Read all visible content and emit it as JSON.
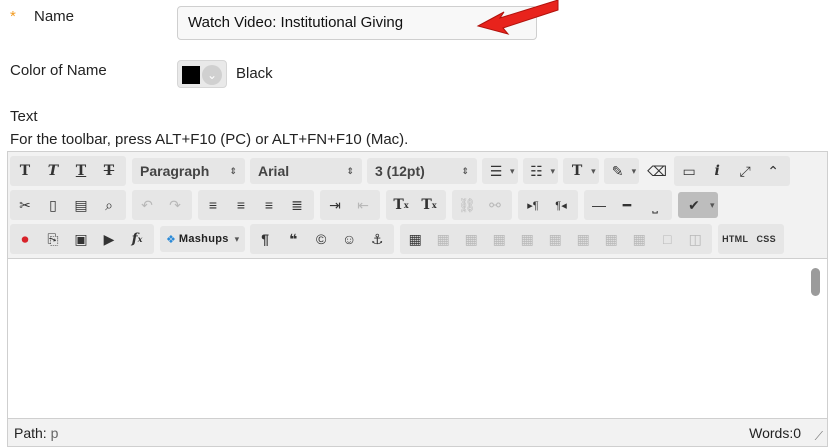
{
  "form": {
    "required_marker": "*",
    "name_label": "Name",
    "name_value": "Watch Video: Institutional Giving",
    "color_label": "Color of Name",
    "color_value": "Black",
    "color_swatch": "#000000",
    "text_label": "Text",
    "toolbar_hint": "For the toolbar, press ALT+F10 (PC) or ALT+FN+F10 (Mac)."
  },
  "toolbar": {
    "paragraph_select": "Paragraph",
    "font_select": "Arial",
    "size_select": "3 (12pt)",
    "mashups_label": "Mashups",
    "html_label": "HTML",
    "css_label": "CSS"
  },
  "status": {
    "path_label": "Path:",
    "path_value": "p",
    "words_label": "Words:0"
  },
  "colors": {
    "required": "#f29a1f",
    "arrow": "#e8231c"
  }
}
